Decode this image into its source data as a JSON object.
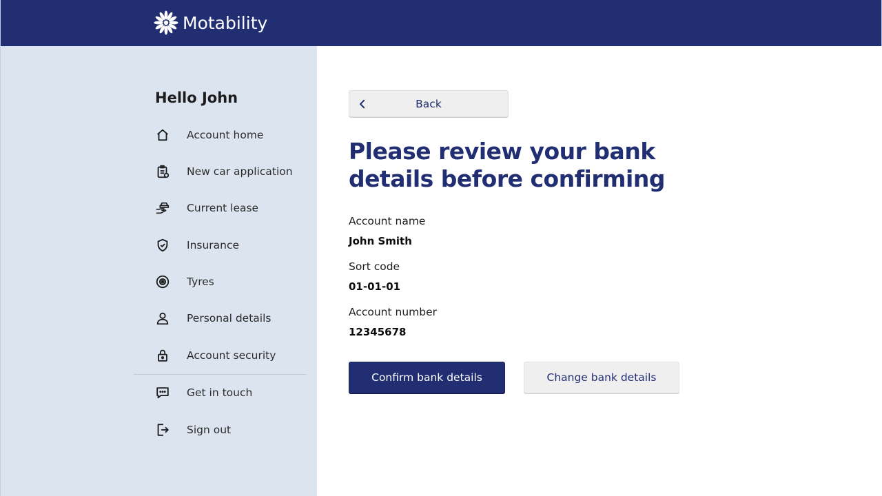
{
  "header": {
    "brand_name": "Motability",
    "logo_icon": "sunburst-logo-icon",
    "background_color": "#222e72"
  },
  "sidebar": {
    "greeting": "Hello John",
    "items": [
      {
        "label": "Account home",
        "icon": "house-icon"
      },
      {
        "label": "New car application",
        "icon": "clipboard-icon"
      },
      {
        "label": "Current lease",
        "icon": "hand-car-icon"
      },
      {
        "label": "Insurance",
        "icon": "shield-check-icon"
      },
      {
        "label": "Tyres",
        "icon": "tyre-icon"
      },
      {
        "label": "Personal details",
        "icon": "person-icon"
      },
      {
        "label": "Account security",
        "icon": "padlock-icon"
      },
      {
        "label": "Get in touch",
        "icon": "chat-bubble-icon"
      },
      {
        "label": "Sign out",
        "icon": "sign-out-icon"
      }
    ],
    "background_color": "#dce4ef"
  },
  "main": {
    "back_label": "Back",
    "title": "Please review your bank details before confirming",
    "details": [
      {
        "label": "Account name",
        "value": "John Smith"
      },
      {
        "label": "Sort code",
        "value": "01-01-01"
      },
      {
        "label": "Account number",
        "value": "12345678"
      }
    ],
    "confirm_label": "Confirm bank details",
    "change_label": "Change bank details",
    "accent_color": "#222e72"
  }
}
